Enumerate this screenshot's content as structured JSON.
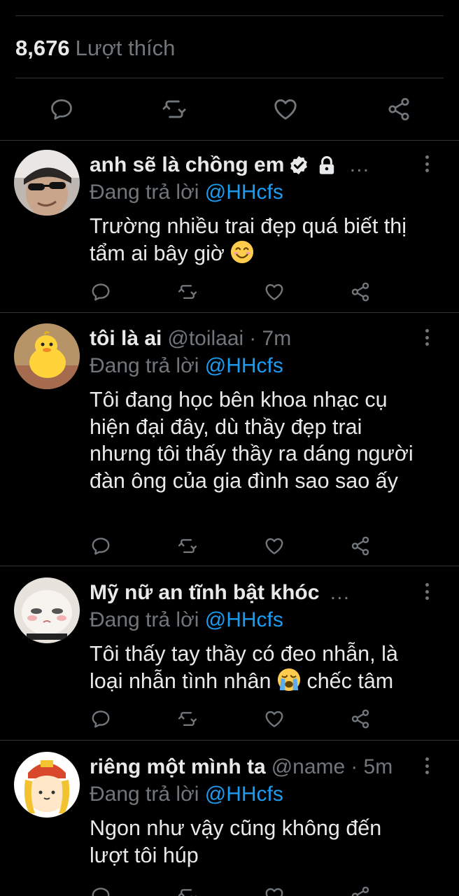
{
  "stats": {
    "likes_count": "8,676",
    "likes_label": "Lượt thích"
  },
  "replies": [
    {
      "name": "anh sẽ là chồng em",
      "handle": "",
      "time": "",
      "truncated": "…",
      "verified": true,
      "protected": true,
      "replying_prefix": "Đang trả lời",
      "replying_to": "@HHcfs",
      "text": "Trường nhiều trai đẹp quá biết thị tẩm ai bây giờ",
      "emoji": "smiling-face"
    },
    {
      "name": "tôi là ai",
      "handle": "@toilaai",
      "time": "· 7m",
      "truncated": "",
      "replying_prefix": "Đang trả lời",
      "replying_to": "@HHcfs",
      "text": "Tôi đang học bên khoa nhạc cụ hiện đại đây, dù thầy đẹp trai nhưng tôi thấy thầy ra dáng người đàn ông của gia đình sao sao ấy"
    },
    {
      "name": "Mỹ nữ an tĩnh bật khóc",
      "handle": "",
      "time": "",
      "truncated": "…",
      "replying_prefix": "Đang trả lời",
      "replying_to": "@HHcfs",
      "text_before": "Tôi thấy tay thầy có đeo nhẫn, là loại nhẫn tình nhân",
      "emoji": "loudly-crying-face",
      "text_after": "chếc tâm"
    },
    {
      "name": "riêng một mình ta",
      "handle": "@name",
      "time": "· 5m",
      "truncated": "",
      "replying_prefix": "Đang trả lời",
      "replying_to": "@HHcfs",
      "text": "Ngon như vậy cũng không đến lượt tôi húp"
    }
  ],
  "icons": {
    "reply": "speech-bubble-icon",
    "retweet": "retweet-arrows-icon",
    "like": "heart-outline-icon",
    "share": "share-nodes-icon",
    "more": "vertical-dots-icon"
  },
  "colors": {
    "background": "#000000",
    "text": "#e7e9ea",
    "muted": "#71767b",
    "accent": "#1d9bf0",
    "divider": "#2f3336"
  }
}
